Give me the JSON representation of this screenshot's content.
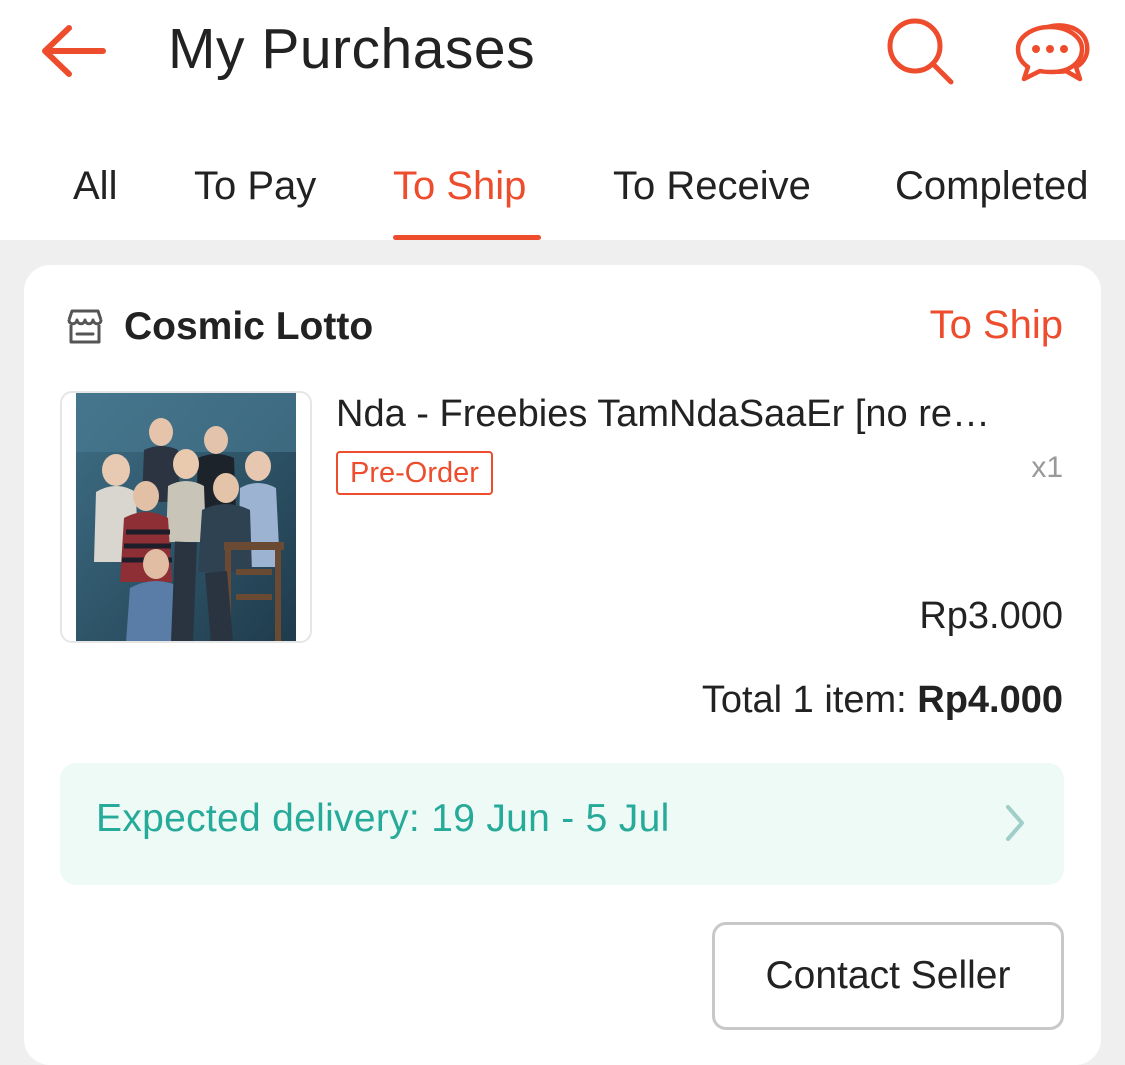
{
  "header": {
    "title": "My Purchases",
    "back_icon": "arrow-left-icon",
    "search_icon": "search-icon",
    "chat_icon": "chat-bubbles-icon",
    "accent_color": "#ee4d2d"
  },
  "tabs": [
    {
      "label": "All",
      "active": false
    },
    {
      "label": "To Pay",
      "active": false
    },
    {
      "label": "To Ship",
      "active": true
    },
    {
      "label": "To Receive",
      "active": false
    },
    {
      "label": "Completed",
      "active": false
    }
  ],
  "order": {
    "shop_icon": "store-icon",
    "shop_name": "Cosmic Lotto",
    "status": "To Ship",
    "product": {
      "name": "Nda - Freebies TamNdaSaaEr [no re…",
      "badge": "Pre-Order",
      "quantity": "x1",
      "price": "Rp3.000"
    },
    "total_label": "Total 1 item: ",
    "total_amount": "Rp4.000",
    "delivery": {
      "text": "Expected delivery: 19 Jun - 5 Jul",
      "color": "#26aa99",
      "chevron_icon": "chevron-right-icon"
    },
    "contact_button": "Contact Seller"
  }
}
